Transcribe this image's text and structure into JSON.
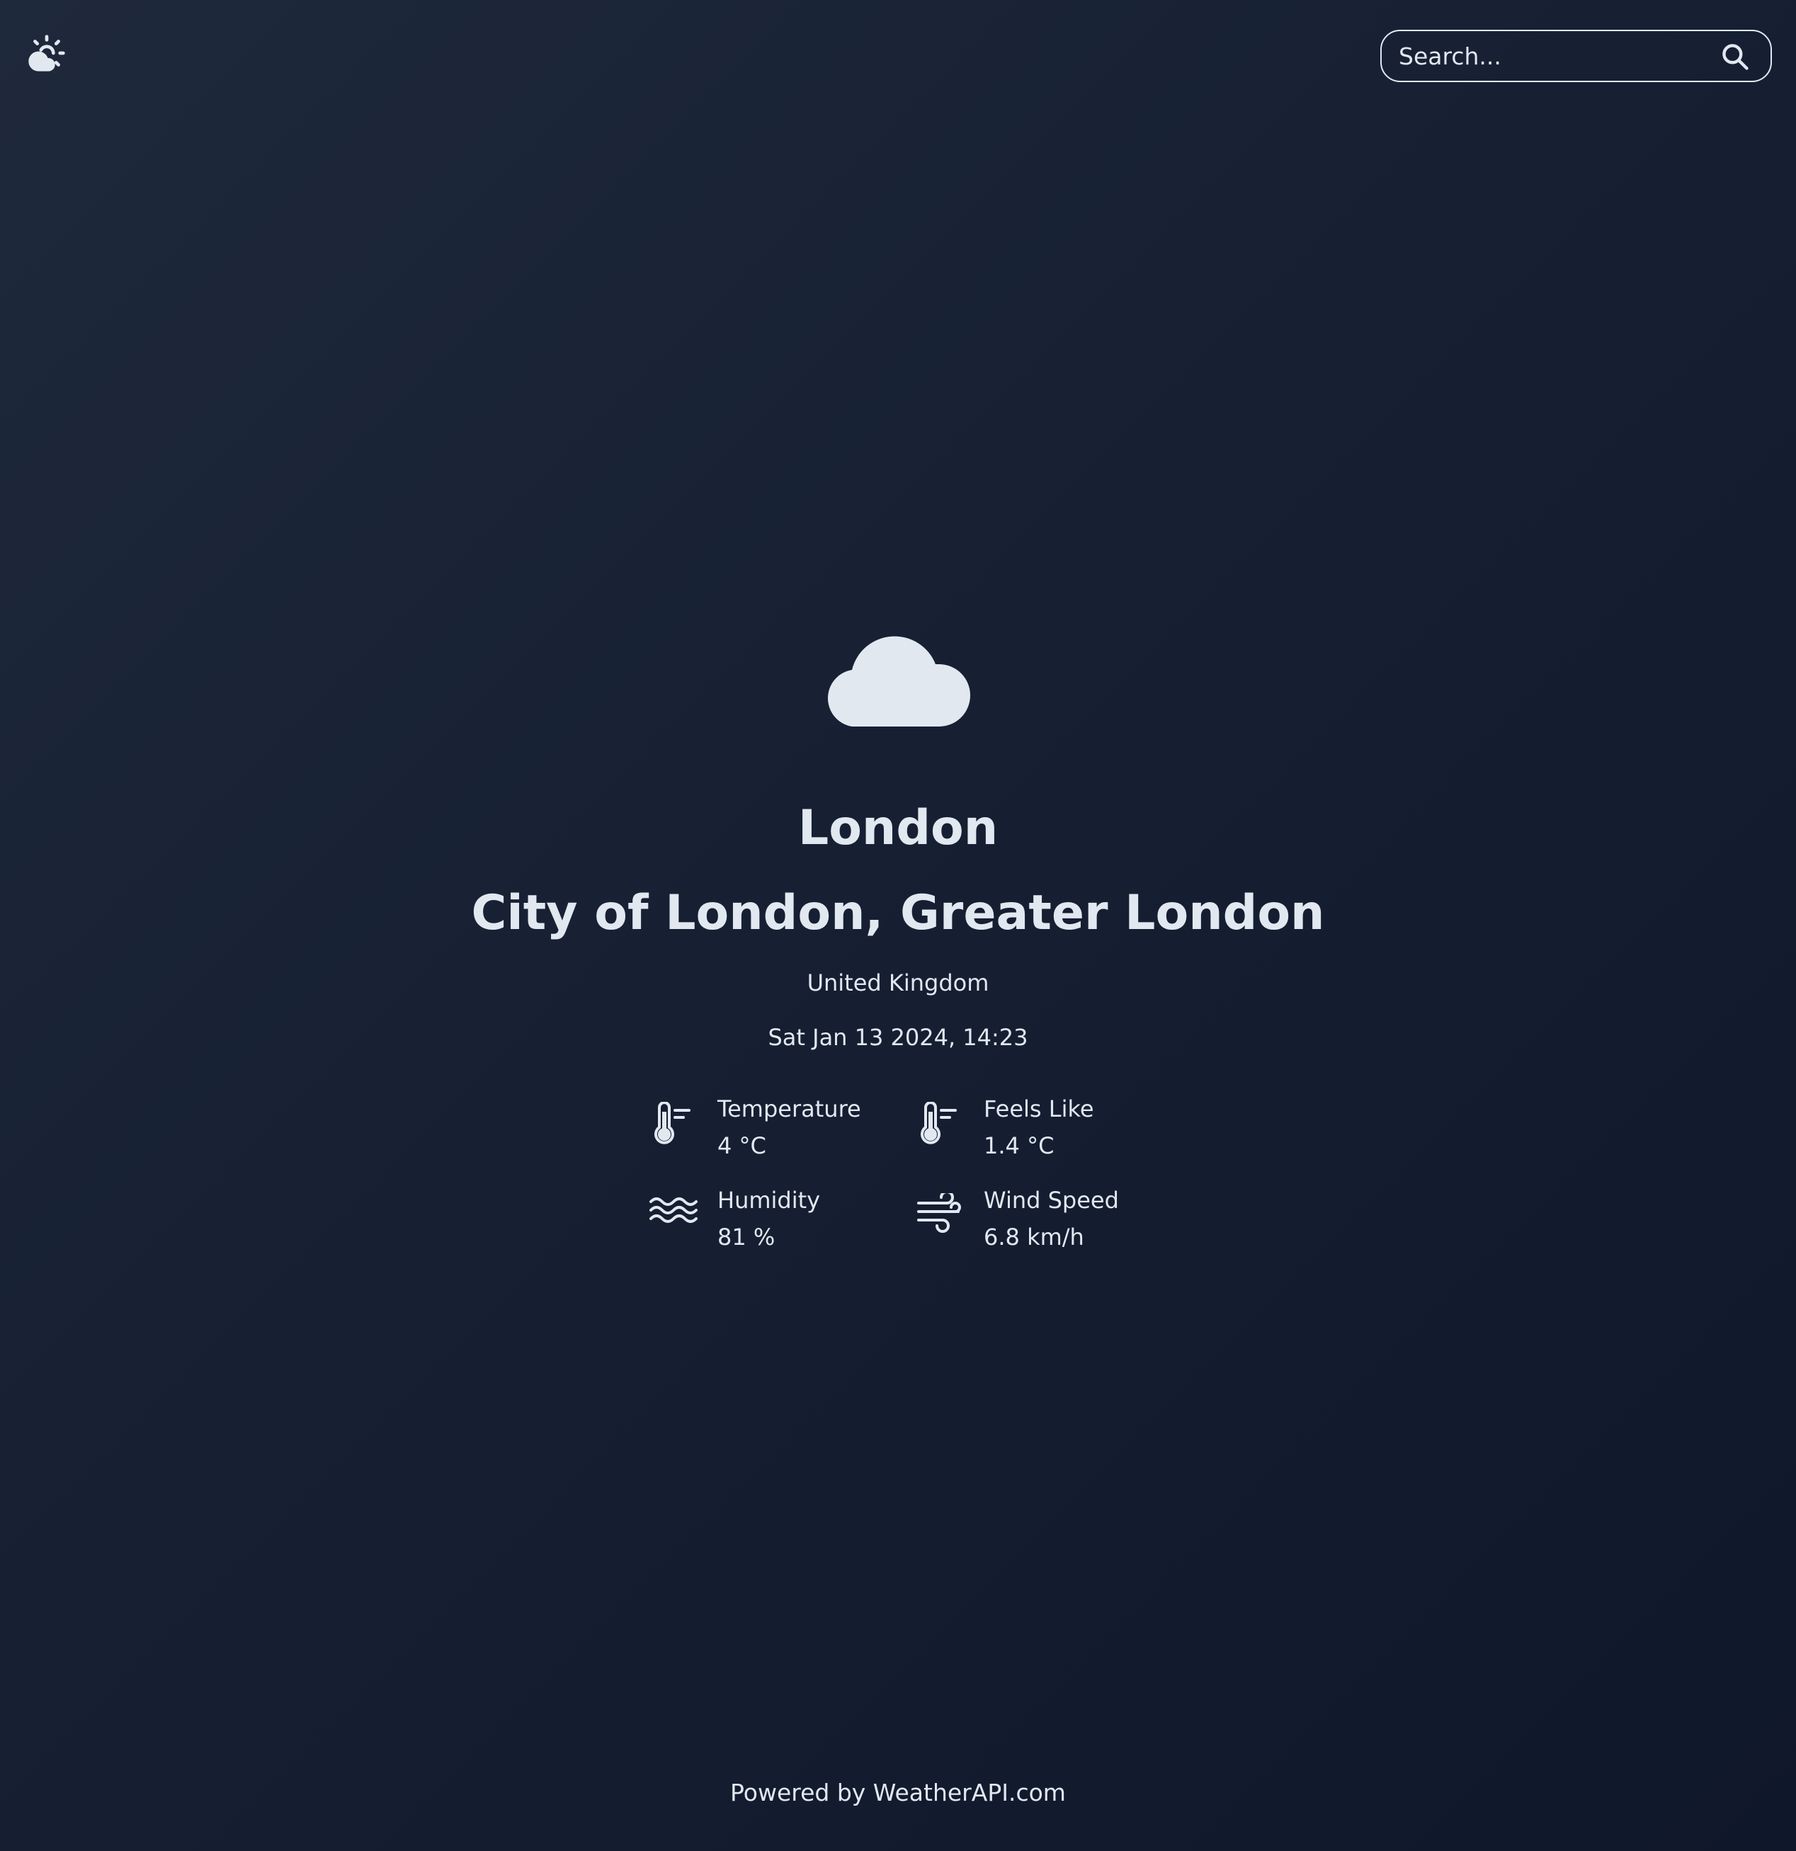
{
  "header": {
    "logo_icon": "sun-cloud-icon",
    "search": {
      "placeholder": "Search...",
      "value": "",
      "button_icon": "search-icon"
    }
  },
  "weather": {
    "condition_icon": "cloud-icon",
    "city": "London",
    "region": "City of London, Greater London",
    "country": "United Kingdom",
    "datetime": "Sat Jan 13 2024, 14:23",
    "stats": [
      {
        "label": "Temperature",
        "value": "4 °C",
        "icon": "thermometer-icon"
      },
      {
        "label": "Feels Like",
        "value": "1.4 °C",
        "icon": "thermometer-icon"
      },
      {
        "label": "Humidity",
        "value": "81 %",
        "icon": "water-waves-icon"
      },
      {
        "label": "Wind Speed",
        "value": "6.8 km/h",
        "icon": "wind-icon"
      }
    ]
  },
  "footer": {
    "text": "Powered by WeatherAPI.com"
  },
  "colors": {
    "background_start": "#1e293b",
    "background_end": "#0f172a",
    "foreground": "#e2e8f0"
  }
}
